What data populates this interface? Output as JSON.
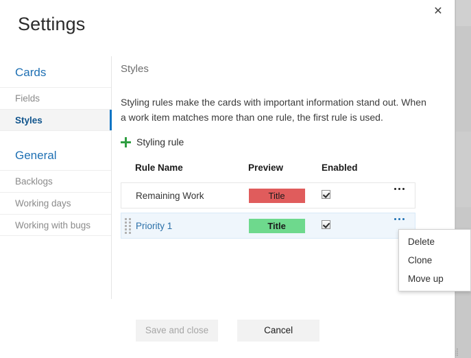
{
  "dialog": {
    "title": "Settings",
    "close_icon": "close-icon"
  },
  "sidebar": {
    "groups": [
      {
        "title": "Cards",
        "items": [
          {
            "label": "Fields",
            "selected": false
          },
          {
            "label": "Styles",
            "selected": true
          }
        ]
      },
      {
        "title": "General",
        "items": [
          {
            "label": "Backlogs",
            "selected": false
          },
          {
            "label": "Working days",
            "selected": false
          },
          {
            "label": "Working with bugs",
            "selected": false
          }
        ]
      }
    ]
  },
  "content": {
    "section_title": "Styles",
    "description": "Styling rules make the cards with important information stand out. When a work item matches more than one rule, the first rule is used.",
    "add_rule": {
      "label": "Styling rule",
      "icon": "plus-icon",
      "icon_color": "#2f9e41"
    },
    "table": {
      "headers": {
        "rule_name": "Rule Name",
        "preview": "Preview",
        "enabled": "Enabled"
      },
      "rows": [
        {
          "name": "Remaining Work",
          "preview_label": "Title",
          "preview_color": "#e05c5c",
          "preview_bold": false,
          "enabled": true,
          "selected": false,
          "has_drag_handle": false,
          "menu_icon": "ellipsis-icon"
        },
        {
          "name": "Priority 1",
          "preview_label": "Title",
          "preview_color": "#6ed98d",
          "preview_bold": true,
          "enabled": true,
          "selected": true,
          "has_drag_handle": true,
          "menu_icon": "ellipsis-icon"
        }
      ]
    }
  },
  "context_menu": {
    "items": [
      {
        "label": "Delete"
      },
      {
        "label": "Clone"
      },
      {
        "label": "Move up"
      }
    ]
  },
  "footer": {
    "save_label": "Save and close",
    "save_disabled": true,
    "cancel_label": "Cancel"
  },
  "colors": {
    "accent": "#0a74c4",
    "link": "#1d6fb3",
    "selected_row": "#eff6fc",
    "red_chip": "#e05c5c",
    "green_chip": "#6ed98d"
  }
}
